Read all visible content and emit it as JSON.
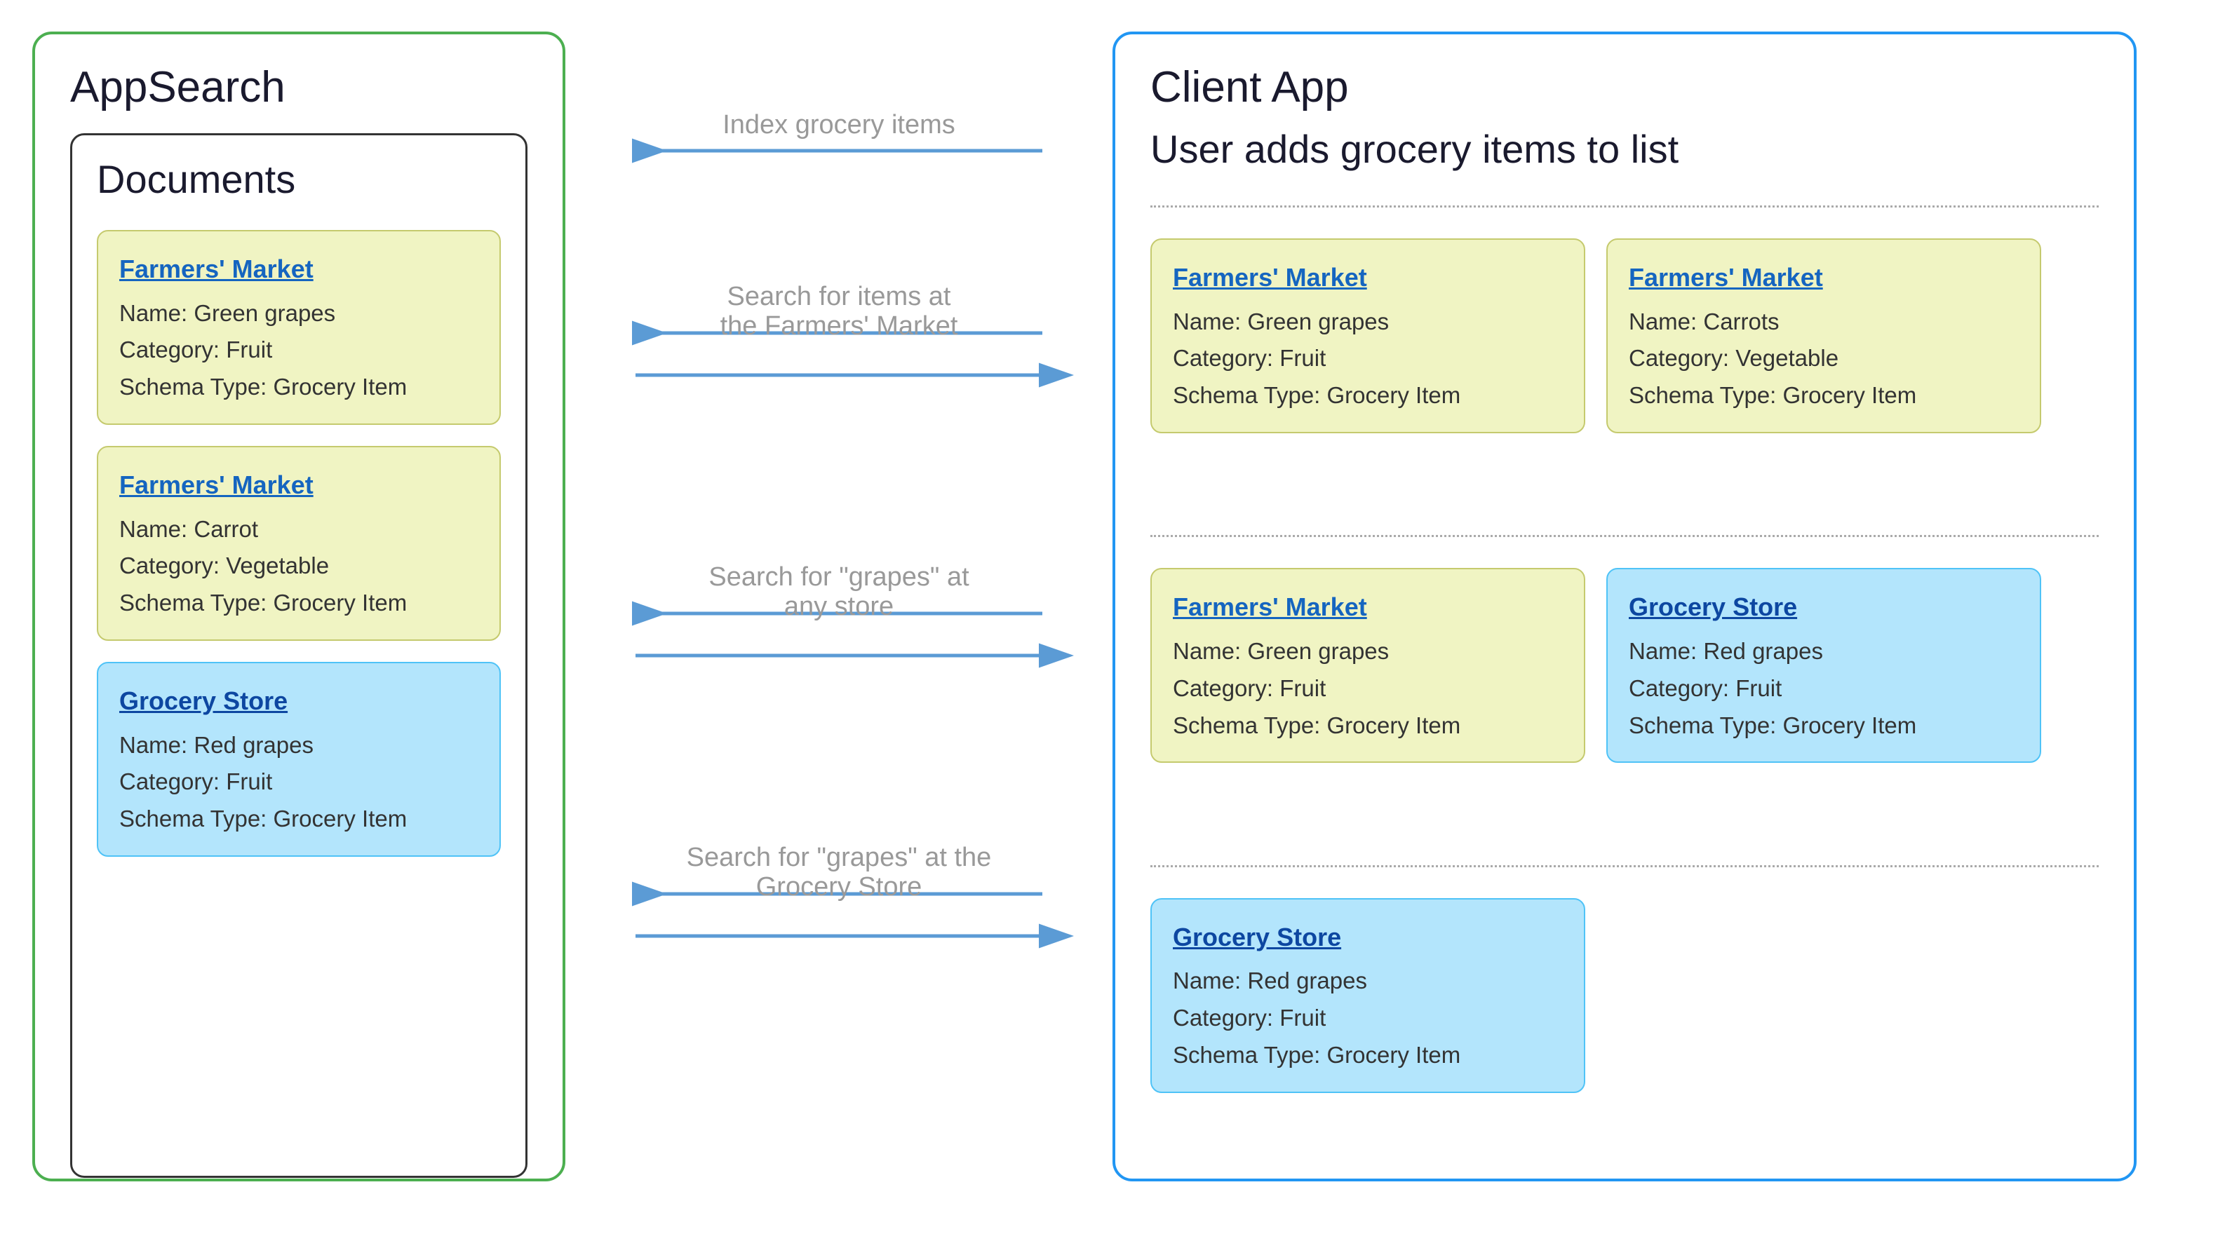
{
  "appsearch": {
    "title": "AppSearch",
    "documents_title": "Documents",
    "cards": [
      {
        "id": "card-fm-grapes",
        "type": "yellow",
        "store": "Farmers' Market",
        "name": "Name: Green grapes",
        "category": "Category: Fruit",
        "schema": "Schema Type: Grocery Item"
      },
      {
        "id": "card-fm-carrot",
        "type": "yellow",
        "store": "Farmers' Market",
        "name": "Name: Carrot",
        "category": "Category: Vegetable",
        "schema": "Schema Type: Grocery Item"
      },
      {
        "id": "card-gs-redgrapes",
        "type": "blue",
        "store": "Grocery Store",
        "name": "Name: Red grapes",
        "category": "Category: Fruit",
        "schema": "Schema Type: Grocery Item"
      }
    ]
  },
  "clientapp": {
    "title": "Client App",
    "user_adds_title": "User adds grocery items to list",
    "sections": [
      {
        "cards": [
          {
            "type": "yellow",
            "store": "Farmers' Market",
            "name": "Name: Green grapes",
            "category": "Category: Fruit",
            "schema": "Schema Type: Grocery Item"
          },
          {
            "type": "yellow",
            "store": "Farmers' Market",
            "name": "Name: Carrots",
            "category": "Category: Vegetable",
            "schema": "Schema Type: Grocery Item"
          }
        ]
      },
      {
        "cards": [
          {
            "type": "yellow",
            "store": "Farmers' Market",
            "name": "Name: Green grapes",
            "category": "Category: Fruit",
            "schema": "Schema Type: Grocery Item"
          },
          {
            "type": "blue",
            "store": "Grocery Store",
            "name": "Name: Red grapes",
            "category": "Category: Fruit",
            "schema": "Schema Type: Grocery Item"
          }
        ]
      },
      {
        "cards": [
          {
            "type": "blue",
            "store": "Grocery Store",
            "name": "Name: Red grapes",
            "category": "Category: Fruit",
            "schema": "Schema Type: Grocery Item"
          }
        ]
      }
    ]
  },
  "arrows": [
    {
      "id": "arrow-index",
      "label": "Index grocery items",
      "direction": "left"
    },
    {
      "id": "arrow-search-farmers",
      "label": "Search for items at\nthe Farmers' Market",
      "direction": "both"
    },
    {
      "id": "arrow-search-grapes",
      "label": "Search for \"grapes\" at\nany store",
      "direction": "both"
    },
    {
      "id": "arrow-search-grocery",
      "label": "Search for \"grapes\" at the\nGrocery Store",
      "direction": "both"
    }
  ]
}
